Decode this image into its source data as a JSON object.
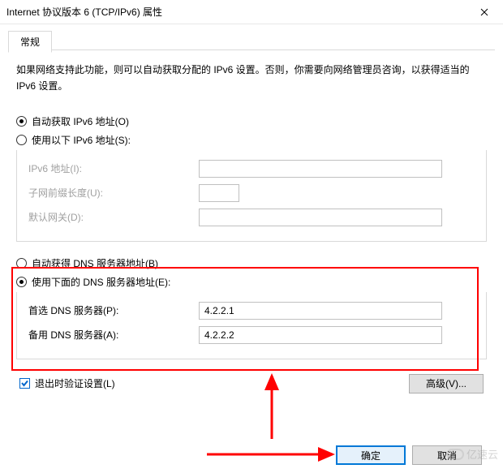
{
  "window": {
    "title": "Internet 协议版本 6 (TCP/IPv6) 属性"
  },
  "tabs": {
    "general": "常规"
  },
  "instruction": "如果网络支持此功能，则可以自动获取分配的 IPv6 设置。否则，你需要向网络管理员咨询，以获得适当的 IPv6 设置。",
  "address": {
    "auto_label": "自动获取 IPv6 地址(O)",
    "manual_label": "使用以下 IPv6 地址(S):",
    "selected": "auto",
    "ip_label": "IPv6 地址(I):",
    "ip_value": "",
    "prefix_label": "子网前缀长度(U):",
    "prefix_value": "",
    "gateway_label": "默认网关(D):",
    "gateway_value": ""
  },
  "dns": {
    "auto_label": "自动获得 DNS 服务器地址(B)",
    "manual_label": "使用下面的 DNS 服务器地址(E):",
    "selected": "manual",
    "preferred_label": "首选 DNS 服务器(P):",
    "preferred_value": "4.2.2.1",
    "alternate_label": "备用 DNS 服务器(A):",
    "alternate_value": "4.2.2.2"
  },
  "validate": {
    "label": "退出时验证设置(L)",
    "checked": true
  },
  "buttons": {
    "advanced": "高级(V)...",
    "ok": "确定",
    "cancel": "取消"
  },
  "watermark": "亿速云",
  "colors": {
    "highlight": "#ff0000",
    "accent": "#0078d7"
  }
}
